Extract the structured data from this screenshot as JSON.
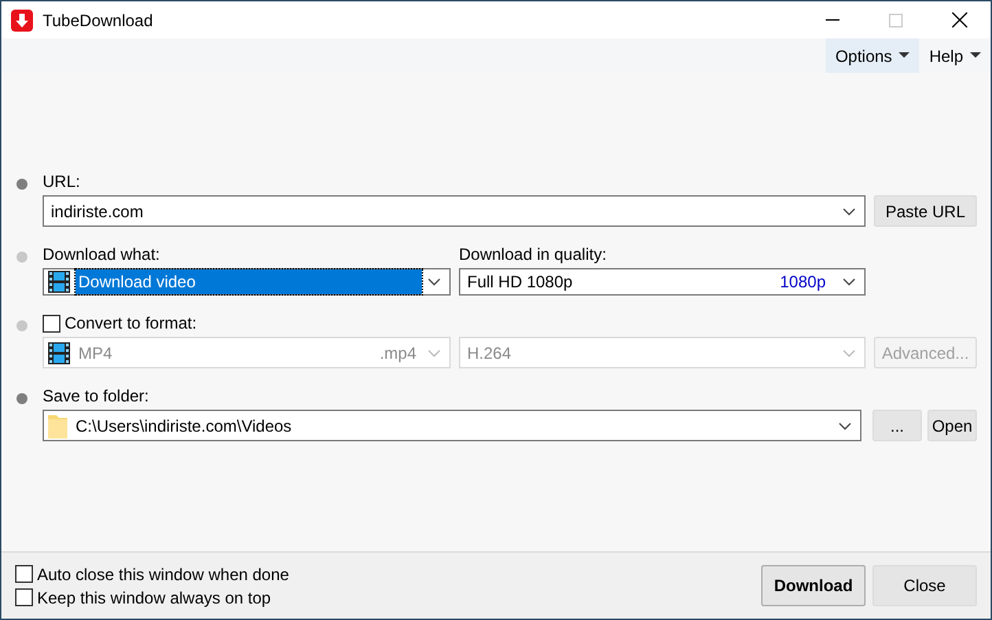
{
  "window": {
    "title": "TubeDownload"
  },
  "menu": [
    {
      "label": "Options",
      "selected": true
    },
    {
      "label": "Help",
      "selected": false
    }
  ],
  "url": {
    "color": "#7f7f7f",
    "label": "URL:",
    "value": "indiriste.com",
    "button": "Paste URL"
  },
  "download_what": {
    "color": "#c8c8c8",
    "label": "Download what:",
    "value": "Download video",
    "highlighted": true
  },
  "quality": {
    "label": "Download in quality:",
    "value": "Full HD 1080p",
    "tag": "1080p"
  },
  "convert": {
    "color": "#c8c8c8",
    "label": "Convert to format:",
    "checked": false,
    "disabled": true,
    "format": "MP4",
    "extension": ".mp4",
    "codec": "H.264",
    "button": "Advanced..."
  },
  "save": {
    "color": "#7f7f7f",
    "label": "Save to folder:",
    "value": "C:\\Users\\indiriste.com\\Videos",
    "buttons": [
      "...",
      "Open"
    ]
  },
  "footer_options": [
    {
      "label": "Auto close this window when done",
      "checked": false
    },
    {
      "label": "Keep this window always on top",
      "checked": false
    }
  ],
  "buttons": [
    {
      "label": "Download",
      "kind": "primary"
    },
    {
      "label": "Close",
      "kind": "normal"
    }
  ]
}
